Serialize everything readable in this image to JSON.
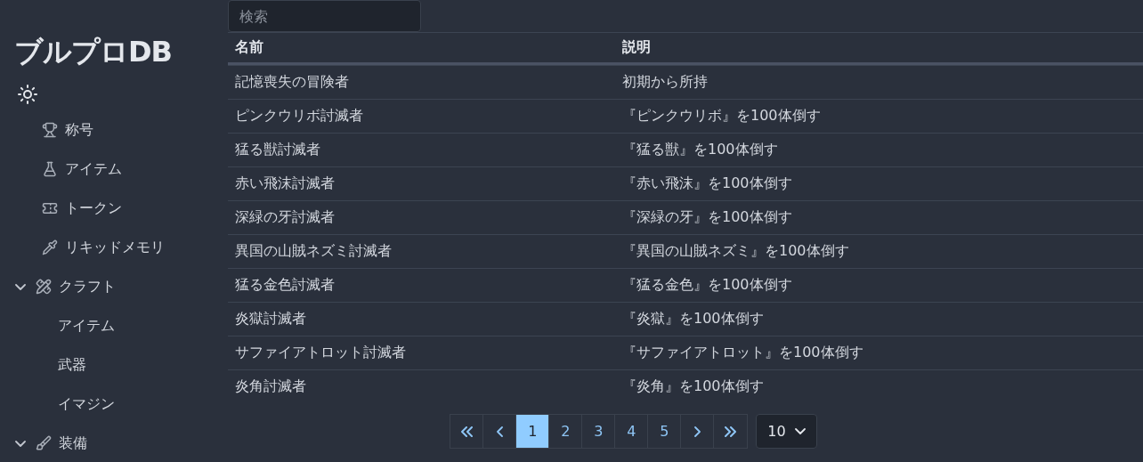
{
  "sidebar": {
    "title": "ブルプロDB",
    "items": [
      {
        "kind": "item",
        "label": "称号"
      },
      {
        "kind": "item",
        "label": "アイテム"
      },
      {
        "kind": "item",
        "label": "トークン"
      },
      {
        "kind": "item",
        "label": "リキッドメモリ"
      },
      {
        "kind": "group",
        "label": "クラフト",
        "expanded": true,
        "children": [
          {
            "label": "アイテム"
          },
          {
            "label": "武器"
          },
          {
            "label": "イマジン"
          }
        ]
      },
      {
        "kind": "group",
        "label": "装備",
        "expanded": true
      }
    ]
  },
  "search": {
    "placeholder": "検索"
  },
  "table": {
    "columns": [
      "名前",
      "説明"
    ],
    "rows": [
      [
        "記憶喪失の冒険者",
        "初期から所持"
      ],
      [
        "ピンクウリボ討滅者",
        "『ピンクウリボ』を100体倒す"
      ],
      [
        "猛る獣討滅者",
        "『猛る獣』を100体倒す"
      ],
      [
        "赤い飛沫討滅者",
        "『赤い飛沫』を100体倒す"
      ],
      [
        "深緑の牙討滅者",
        "『深緑の牙』を100体倒す"
      ],
      [
        "異国の山賊ネズミ討滅者",
        "『異国の山賊ネズミ』を100体倒す"
      ],
      [
        "猛る金色討滅者",
        "『猛る金色』を100体倒す"
      ],
      [
        "炎獄討滅者",
        "『炎獄』を100体倒す"
      ],
      [
        "サファイアトロット討滅者",
        "『サファイアトロット』を100体倒す"
      ],
      [
        "炎角討滅者",
        "『炎角』を100体倒す"
      ]
    ]
  },
  "pagination": {
    "pages": [
      {
        "label": "1",
        "selected": true
      },
      {
        "label": "2",
        "selected": false
      },
      {
        "label": "3",
        "selected": false
      },
      {
        "label": "4",
        "selected": false
      },
      {
        "label": "5",
        "selected": false
      }
    ],
    "page_size": "10"
  }
}
